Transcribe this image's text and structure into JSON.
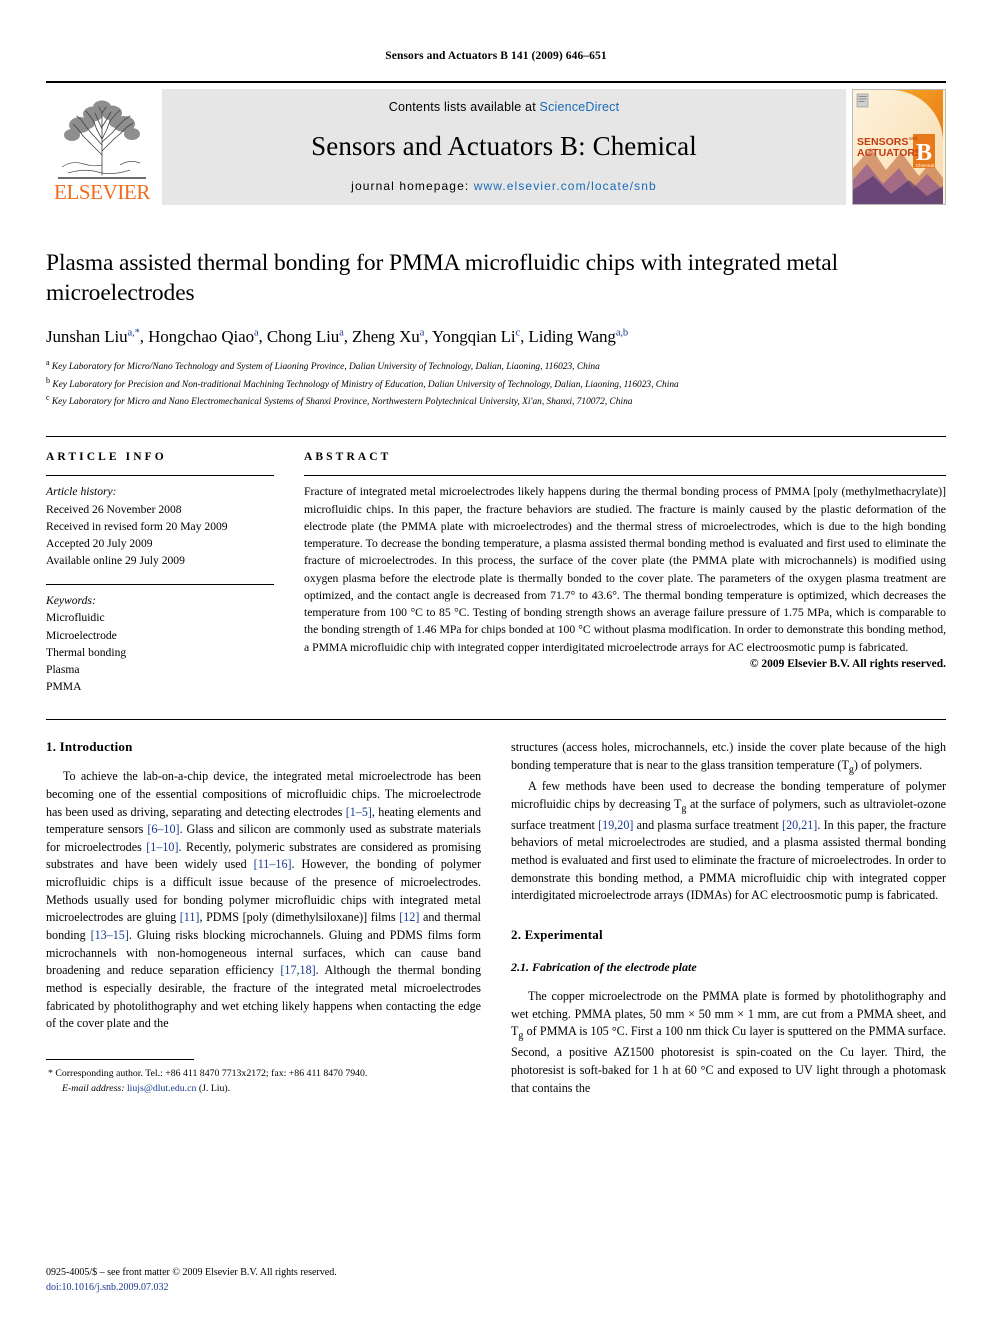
{
  "running_head": "Sensors and Actuators B 141 (2009) 646–651",
  "masthead": {
    "contents_prefix": "Contents lists available at ",
    "sciencedirect": "ScienceDirect",
    "journal_title": "Sensors and Actuators B: Chemical",
    "homepage_label": "journal homepage:",
    "homepage_url": "www.elsevier.com/locate/snb",
    "publisher": "ELSEVIER",
    "cover": {
      "line1": "SENSORS",
      "line1_small": "and",
      "line2": "ACTUATORS",
      "letter": "B",
      "sub": "Chemical"
    }
  },
  "title": "Plasma assisted thermal bonding for PMMA microfluidic chips with integrated metal microelectrodes",
  "authors": [
    {
      "name": "Junshan Liu",
      "sup": "a,*"
    },
    {
      "name": "Hongchao Qiao",
      "sup": "a"
    },
    {
      "name": "Chong Liu",
      "sup": "a"
    },
    {
      "name": "Zheng Xu",
      "sup": "a"
    },
    {
      "name": "Yongqian Li",
      "sup": "c"
    },
    {
      "name": "Liding Wang",
      "sup": "a,b"
    }
  ],
  "affiliations": [
    {
      "mark": "a",
      "text": "Key Laboratory for Micro/Nano Technology and System of Liaoning Province, Dalian University of Technology, Dalian, Liaoning, 116023, China"
    },
    {
      "mark": "b",
      "text": "Key Laboratory for Precision and Non-traditional Machining Technology of Ministry of Education, Dalian University of Technology, Dalian, Liaoning, 116023, China"
    },
    {
      "mark": "c",
      "text": "Key Laboratory for Micro and Nano Electromechanical Systems of Shanxi Province, Northwestern Polytechnical University, Xi'an, Shanxi, 710072, China"
    }
  ],
  "article_info": {
    "heading": "ARTICLE INFO",
    "history_label": "Article history:",
    "history": [
      "Received 26 November 2008",
      "Received in revised form 20 May 2009",
      "Accepted 20 July 2009",
      "Available online 29 July 2009"
    ],
    "keywords_label": "Keywords:",
    "keywords": [
      "Microfluidic",
      "Microelectrode",
      "Thermal bonding",
      "Plasma",
      "PMMA"
    ]
  },
  "abstract": {
    "heading": "ABSTRACT",
    "text": "Fracture of integrated metal microelectrodes likely happens during the thermal bonding process of PMMA [poly (methylmethacrylate)] microfluidic chips. In this paper, the fracture behaviors are studied. The fracture is mainly caused by the plastic deformation of the electrode plate (the PMMA plate with microelectrodes) and the thermal stress of microelectrodes, which is due to the high bonding temperature. To decrease the bonding temperature, a plasma assisted thermal bonding method is evaluated and first used to eliminate the fracture of microelectrodes. In this process, the surface of the cover plate (the PMMA plate with microchannels) is modified using oxygen plasma before the electrode plate is thermally bonded to the cover plate. The parameters of the oxygen plasma treatment are optimized, and the contact angle is decreased from 71.7° to 43.6°. The thermal bonding temperature is optimized, which decreases the temperature from 100 °C to 85 °C. Testing of bonding strength shows an average failure pressure of 1.75 MPa, which is comparable to the bonding strength of 1.46 MPa for chips bonded at 100 °C without plasma modification. In order to demonstrate this bonding method, a PMMA microfluidic chip with integrated copper interdigitated microelectrode arrays for AC electroosmotic pump is fabricated.",
    "copyright": "© 2009 Elsevier B.V. All rights reserved."
  },
  "sections": {
    "introduction_heading": "1. Introduction",
    "experimental_heading": "2. Experimental",
    "subsection_heading": "2.1. Fabrication of the electrode plate"
  },
  "body": {
    "left_p1_a": "To achieve the lab-on-a-chip device, the integrated metal microelectrode has been becoming one of the essential compositions of microfluidic chips. The microelectrode has been used as driving, separating and detecting electrodes ",
    "cite_1_5": "[1–5]",
    "left_p1_b": ", heating elements and temperature sensors ",
    "cite_6_10": "[6–10]",
    "left_p1_c": ". Glass and silicon are commonly used as substrate materials for microelectrodes ",
    "cite_1_10": "[1–10]",
    "left_p1_d": ". Recently, polymeric substrates are considered as promising substrates and have been widely used ",
    "cite_11_16": "[11–16]",
    "left_p1_e": ". However, the bonding of polymer microfluidic chips is a difficult issue because of the presence of microelectrodes. Methods usually used for bonding polymer microfluidic chips with integrated metal microelectrodes are gluing ",
    "cite_11": "[11]",
    "left_p1_f": ", PDMS [poly (dimethylsiloxane)] films ",
    "cite_12": "[12]",
    "left_p1_g": " and thermal bonding ",
    "cite_13_15": "[13–15]",
    "left_p1_h": ". Gluing risks blocking microchannels. Gluing and PDMS films form microchannels with non-homogeneous internal surfaces, which can cause band broadening and reduce separation efficiency ",
    "cite_17_18": "[17,18]",
    "left_p1_i": ". Although the thermal bonding method is especially desirable, the fracture of the integrated metal microelectrodes fabricated by photolithography and wet etching likely happens when contacting the edge of the cover plate and the",
    "right_p1": "structures (access holes, microchannels, etc.) inside the cover plate because of the high bonding temperature that is near to the glass transition temperature (T",
    "right_p1_sub": "g",
    "right_p1_b": ") of polymers.",
    "right_p2_a": "A few methods have been used to decrease the bonding temperature of polymer microfluidic chips by decreasing T",
    "right_p2_sub": "g",
    "right_p2_b": " at the surface of polymers, such as ultraviolet-ozone surface treatment ",
    "cite_19_20": "[19,20]",
    "right_p2_c": " and plasma surface treatment ",
    "cite_20_21": "[20,21]",
    "right_p2_d": ". In this paper, the fracture behaviors of metal microelectrodes are studied, and a plasma assisted thermal bonding method is evaluated and first used to eliminate the fracture of microelectrodes. In order to demonstrate this bonding method, a PMMA microfluidic chip with integrated copper interdigitated microelectrode arrays (IDMAs) for AC electroosmotic pump is fabricated.",
    "right_p3_a": "The copper microelectrode on the PMMA plate is formed by photolithography and wet etching. PMMA plates, 50 mm × 50 mm × 1 mm, are cut from a PMMA sheet, and T",
    "right_p3_sub": "g",
    "right_p3_b": " of PMMA is 105 °C. First a 100 nm thick Cu layer is sputtered on the PMMA surface. Second, a positive AZ1500 photoresist is spin-coated on the Cu layer. Third, the photoresist is soft-baked for 1 h at 60 °C and exposed to UV light through a photomask that contains the"
  },
  "footnote": {
    "marker": "*",
    "corresponding": "Corresponding author. Tel.: +86 411 8470 7713x2172; fax: +86 411 8470 7940.",
    "email_label": "E-mail address:",
    "email": "liujs@dlut.edu.cn",
    "email_suffix": " (J. Liu)."
  },
  "page_footer": {
    "issn_line": "0925-4005/$ – see front matter © 2009 Elsevier B.V. All rights reserved.",
    "doi_line": "doi:10.1016/j.snb.2009.07.032"
  },
  "colors": {
    "link": "#1a6bb5",
    "citation": "#1a3a8f",
    "elsevier_orange": "#F06D1E",
    "masthead_gray": "#e6e6e6"
  }
}
